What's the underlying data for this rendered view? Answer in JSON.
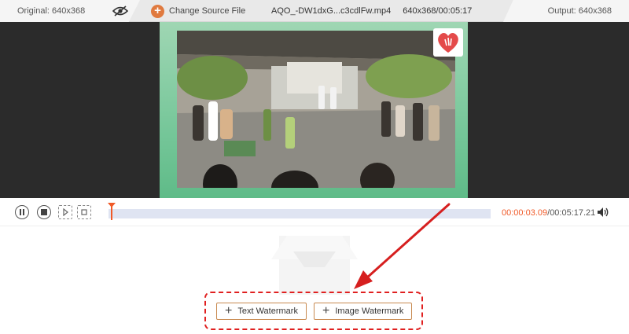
{
  "topbar": {
    "original_label": "Original: 640x368",
    "change_source_label": "Change Source File",
    "file_name": "AQO_-DW1dxG...c3cdlFw.mp4",
    "file_dimensions_time": "640x368/00:05:17",
    "output_label": "Output: 640x368",
    "icons": [
      "eye-hidden-icon",
      "plus-circle-icon"
    ]
  },
  "player": {
    "current_time": "00:00:03.09",
    "separator": "/",
    "total_time": "00:05:17.21",
    "progress_fraction": 0.01,
    "icons": [
      "pause-icon",
      "stop-icon",
      "clip-start-icon",
      "clip-end-icon",
      "volume-icon"
    ]
  },
  "watermark": {
    "text_button_label": "Text Watermark",
    "image_button_label": "Image Watermark"
  },
  "colors": {
    "accent_orange": "#f05a28",
    "highlight_red": "#e02020",
    "frame_green": "#77c79a",
    "timeline_track": "#dfe4f2"
  }
}
